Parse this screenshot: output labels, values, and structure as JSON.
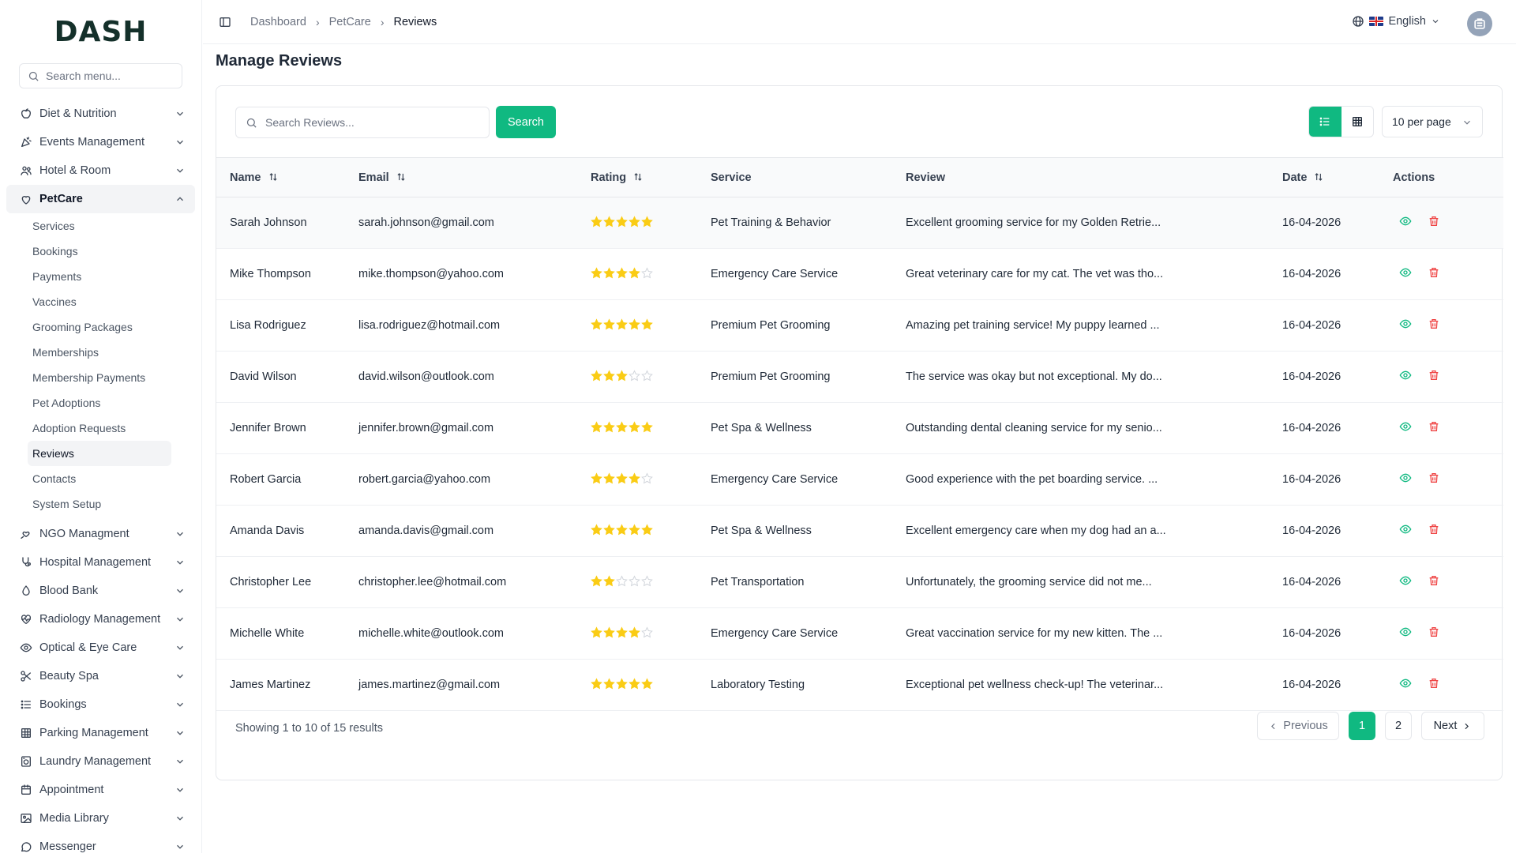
{
  "brand": {
    "logo_text": "DASH"
  },
  "sidebar": {
    "search_placeholder": "Search menu...",
    "items_before": [
      {
        "label": "Diet & Nutrition",
        "icon": "apple-icon"
      },
      {
        "label": "Events Management",
        "icon": "party-icon"
      },
      {
        "label": "Hotel & Room",
        "icon": "users-icon"
      }
    ],
    "open_item": {
      "label": "PetCare",
      "icon": "paw-icon"
    },
    "submenu": [
      "Services",
      "Bookings",
      "Payments",
      "Vaccines",
      "Grooming Packages",
      "Memberships",
      "Membership Payments",
      "Pet Adoptions",
      "Adoption Requests",
      "Reviews",
      "Contacts",
      "System Setup"
    ],
    "active_sub": "Reviews",
    "items_after": [
      {
        "label": "NGO Managment",
        "icon": "hand-heart-icon"
      },
      {
        "label": "Hospital Management",
        "icon": "stethoscope-icon"
      },
      {
        "label": "Blood Bank",
        "icon": "drop-icon"
      },
      {
        "label": "Radiology Management",
        "icon": "heart-icon"
      },
      {
        "label": "Optical & Eye Care",
        "icon": "eye-icon"
      },
      {
        "label": "Beauty Spa",
        "icon": "scissors-icon"
      },
      {
        "label": "Bookings",
        "icon": "list-icon"
      },
      {
        "label": "Parking Management",
        "icon": "grid-icon"
      },
      {
        "label": "Laundry Management",
        "icon": "washer-icon"
      },
      {
        "label": "Appointment",
        "icon": "calendar-icon"
      },
      {
        "label": "Media Library",
        "icon": "image-icon"
      },
      {
        "label": "Messenger",
        "icon": "chat-icon"
      }
    ]
  },
  "header": {
    "breadcrumb": [
      "Dashboard",
      "PetCare",
      "Reviews"
    ],
    "language": "English"
  },
  "page": {
    "title": "Manage Reviews"
  },
  "toolbar": {
    "search_placeholder": "Search Reviews...",
    "search_label": "Search",
    "per_page": "10 per page"
  },
  "table": {
    "columns": [
      "Name",
      "Email",
      "Rating",
      "Service",
      "Review",
      "Date",
      "Actions"
    ],
    "rows": [
      {
        "name": "Sarah Johnson",
        "email": "sarah.johnson@gmail.com",
        "rating": 5,
        "service": "Pet Training & Behavior",
        "review": "Excellent grooming service for my Golden Retrie...",
        "date": "16-04-2026"
      },
      {
        "name": "Mike Thompson",
        "email": "mike.thompson@yahoo.com",
        "rating": 4,
        "service": "Emergency Care Service",
        "review": "Great veterinary care for my cat. The vet was tho...",
        "date": "16-04-2026"
      },
      {
        "name": "Lisa Rodriguez",
        "email": "lisa.rodriguez@hotmail.com",
        "rating": 5,
        "service": "Premium Pet Grooming",
        "review": "Amazing pet training service! My puppy learned ...",
        "date": "16-04-2026"
      },
      {
        "name": "David Wilson",
        "email": "david.wilson@outlook.com",
        "rating": 3,
        "service": "Premium Pet Grooming",
        "review": "The service was okay but not exceptional. My do...",
        "date": "16-04-2026"
      },
      {
        "name": "Jennifer Brown",
        "email": "jennifer.brown@gmail.com",
        "rating": 5,
        "service": "Pet Spa & Wellness",
        "review": "Outstanding dental cleaning service for my senio...",
        "date": "16-04-2026"
      },
      {
        "name": "Robert Garcia",
        "email": "robert.garcia@yahoo.com",
        "rating": 4,
        "service": "Emergency Care Service",
        "review": "Good experience with the pet boarding service. ...",
        "date": "16-04-2026"
      },
      {
        "name": "Amanda Davis",
        "email": "amanda.davis@gmail.com",
        "rating": 5,
        "service": "Pet Spa & Wellness",
        "review": "Excellent emergency care when my dog had an a...",
        "date": "16-04-2026"
      },
      {
        "name": "Christopher Lee",
        "email": "christopher.lee@hotmail.com",
        "rating": 2,
        "service": "Pet Transportation",
        "review": "Unfortunately, the grooming service did not me...",
        "date": "16-04-2026"
      },
      {
        "name": "Michelle White",
        "email": "michelle.white@outlook.com",
        "rating": 4,
        "service": "Emergency Care Service",
        "review": "Great vaccination service for my new kitten. The ...",
        "date": "16-04-2026"
      },
      {
        "name": "James Martinez",
        "email": "james.martinez@gmail.com",
        "rating": 5,
        "service": "Laboratory Testing",
        "review": "Exceptional pet wellness check-up! The veterinar...",
        "date": "16-04-2026"
      }
    ]
  },
  "pagination": {
    "showing": "Showing 1 to 10 of 15 results",
    "previous": "Previous",
    "pages": [
      "1",
      "2"
    ],
    "current": "1",
    "next": "Next"
  },
  "colors": {
    "accent": "#10b981",
    "star": "#facc15",
    "danger": "#ef4444"
  }
}
